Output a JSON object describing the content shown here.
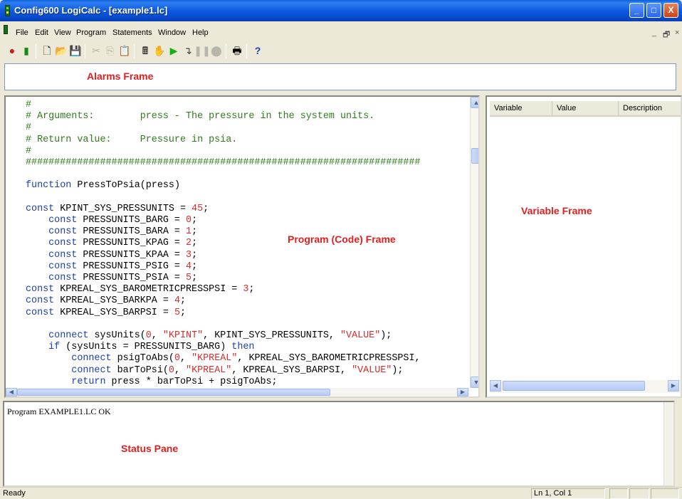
{
  "window": {
    "title": "Config600 LogiCalc - [example1.lc]",
    "minimize": "_",
    "maximize": "□",
    "close": "X",
    "mdi_min": "_",
    "mdi_restore": "🗗",
    "mdi_close": "×"
  },
  "menu": {
    "items": [
      "File",
      "Edit",
      "View",
      "Program",
      "Statements",
      "Window",
      "Help"
    ]
  },
  "toolbar": {
    "icons": [
      "connect-icon",
      "disconnect-icon",
      "new-file-icon",
      "open-folder-icon",
      "save-icon",
      "cut-icon",
      "copy-icon",
      "paste-icon",
      "calculator-icon",
      "hand-icon",
      "run-icon",
      "step-icon",
      "pause-icon",
      "stop-icon",
      "print-icon",
      "help-icon"
    ]
  },
  "labels": {
    "alarms": "Alarms Frame",
    "program": "Program (Code) Frame",
    "variable": "Variable Frame",
    "status": "Status Pane"
  },
  "code": {
    "lines": [
      [
        {
          "t": "#",
          "c": "c"
        }
      ],
      [
        {
          "t": "# Arguments:        press - The pressure in the system units.",
          "c": "c"
        }
      ],
      [
        {
          "t": "#",
          "c": "c"
        }
      ],
      [
        {
          "t": "# Return value:     Pressure in psia.",
          "c": "c"
        }
      ],
      [
        {
          "t": "#",
          "c": "c"
        }
      ],
      [
        {
          "t": "#####################################################################",
          "c": "c"
        }
      ],
      [
        {
          "t": "",
          "c": ""
        }
      ],
      [
        {
          "t": "function",
          "c": "k"
        },
        {
          "t": " PressToPsia(press)",
          "c": ""
        }
      ],
      [
        {
          "t": "",
          "c": ""
        }
      ],
      [
        {
          "t": "const",
          "c": "k"
        },
        {
          "t": " KPINT_SYS_PRESSUNITS = ",
          "c": ""
        },
        {
          "t": "45",
          "c": "n"
        },
        {
          "t": ";",
          "c": ""
        }
      ],
      [
        {
          "t": "    const",
          "c": "k"
        },
        {
          "t": " PRESSUNITS_BARG = ",
          "c": ""
        },
        {
          "t": "0",
          "c": "n"
        },
        {
          "t": ";",
          "c": ""
        }
      ],
      [
        {
          "t": "    const",
          "c": "k"
        },
        {
          "t": " PRESSUNITS_BARA = ",
          "c": ""
        },
        {
          "t": "1",
          "c": "n"
        },
        {
          "t": ";",
          "c": ""
        }
      ],
      [
        {
          "t": "    const",
          "c": "k"
        },
        {
          "t": " PRESSUNITS_KPAG = ",
          "c": ""
        },
        {
          "t": "2",
          "c": "n"
        },
        {
          "t": ";",
          "c": ""
        }
      ],
      [
        {
          "t": "    const",
          "c": "k"
        },
        {
          "t": " PRESSUNITS_KPAA = ",
          "c": ""
        },
        {
          "t": "3",
          "c": "n"
        },
        {
          "t": ";",
          "c": ""
        }
      ],
      [
        {
          "t": "    const",
          "c": "k"
        },
        {
          "t": " PRESSUNITS_PSIG = ",
          "c": ""
        },
        {
          "t": "4",
          "c": "n"
        },
        {
          "t": ";",
          "c": ""
        }
      ],
      [
        {
          "t": "    const",
          "c": "k"
        },
        {
          "t": " PRESSUNITS_PSIA = ",
          "c": ""
        },
        {
          "t": "5",
          "c": "n"
        },
        {
          "t": ";",
          "c": ""
        }
      ],
      [
        {
          "t": "const",
          "c": "k"
        },
        {
          "t": " KPREAL_SYS_BAROMETRICPRESSPSI = ",
          "c": ""
        },
        {
          "t": "3",
          "c": "n"
        },
        {
          "t": ";",
          "c": ""
        }
      ],
      [
        {
          "t": "const",
          "c": "k"
        },
        {
          "t": " KPREAL_SYS_BARKPA = ",
          "c": ""
        },
        {
          "t": "4",
          "c": "n"
        },
        {
          "t": ";",
          "c": ""
        }
      ],
      [
        {
          "t": "const",
          "c": "k"
        },
        {
          "t": " KPREAL_SYS_BARPSI = ",
          "c": ""
        },
        {
          "t": "5",
          "c": "n"
        },
        {
          "t": ";",
          "c": ""
        }
      ],
      [
        {
          "t": "",
          "c": ""
        }
      ],
      [
        {
          "t": "    connect",
          "c": "k"
        },
        {
          "t": " sysUnits(",
          "c": ""
        },
        {
          "t": "0",
          "c": "n"
        },
        {
          "t": ", ",
          "c": ""
        },
        {
          "t": "\"KPINT\"",
          "c": "s"
        },
        {
          "t": ", KPINT_SYS_PRESSUNITS, ",
          "c": ""
        },
        {
          "t": "\"VALUE\"",
          "c": "s"
        },
        {
          "t": ");",
          "c": ""
        }
      ],
      [
        {
          "t": "    if",
          "c": "k"
        },
        {
          "t": " (sysUnits = PRESSUNITS_BARG) ",
          "c": ""
        },
        {
          "t": "then",
          "c": "k"
        }
      ],
      [
        {
          "t": "        connect",
          "c": "k"
        },
        {
          "t": " psigToAbs(",
          "c": ""
        },
        {
          "t": "0",
          "c": "n"
        },
        {
          "t": ", ",
          "c": ""
        },
        {
          "t": "\"KPREAL\"",
          "c": "s"
        },
        {
          "t": ", KPREAL_SYS_BAROMETRICPRESSPSI,",
          "c": ""
        }
      ],
      [
        {
          "t": "        connect",
          "c": "k"
        },
        {
          "t": " barToPsi(",
          "c": ""
        },
        {
          "t": "0",
          "c": "n"
        },
        {
          "t": ", ",
          "c": ""
        },
        {
          "t": "\"KPREAL\"",
          "c": "s"
        },
        {
          "t": ", KPREAL_SYS_BARPSI, ",
          "c": ""
        },
        {
          "t": "\"VALUE\"",
          "c": "s"
        },
        {
          "t": ");",
          "c": ""
        }
      ],
      [
        {
          "t": "        return",
          "c": "k"
        },
        {
          "t": " press * barToPsi + psigToAbs;",
          "c": ""
        }
      ]
    ]
  },
  "variables": {
    "columns": [
      "Variable",
      "Value",
      "Description"
    ]
  },
  "status": {
    "message": "Program EXAMPLE1.LC OK"
  },
  "statusbar": {
    "ready": "Ready",
    "position": "Ln 1, Col 1"
  },
  "colors": {
    "comment": "#2e7d1b",
    "keyword": "#1c3fb2",
    "string": "#d62d2d",
    "label": "#e02020"
  }
}
